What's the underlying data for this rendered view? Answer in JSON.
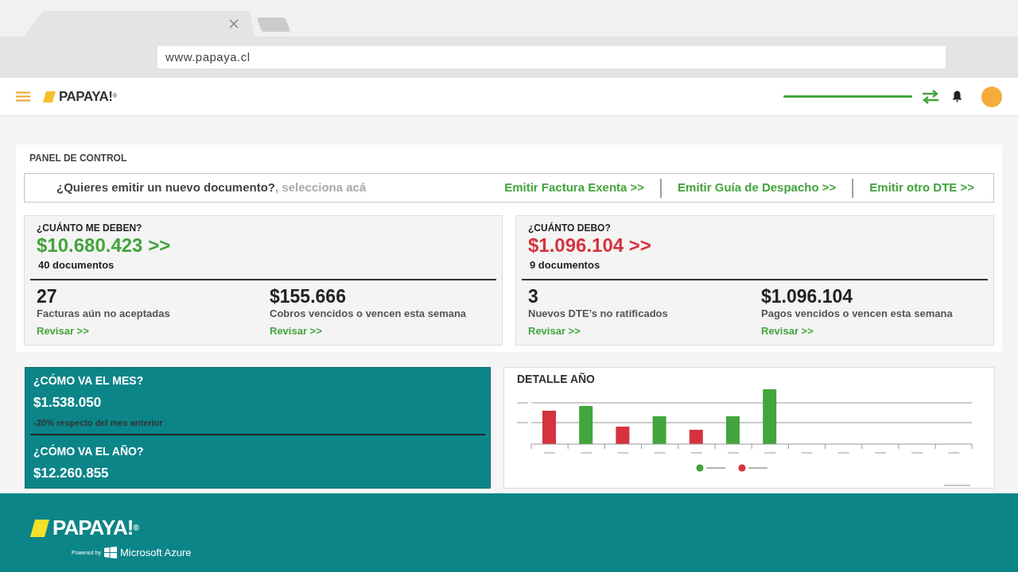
{
  "browser": {
    "url": "www.papaya.cl"
  },
  "header": {
    "logo": "PAPAYA!$^{®}$"
  },
  "panel": {
    "title": "PANEL DE CONTROL",
    "prompt": "¿Quieres emitir un nuevo documento?",
    "hint": ", selecciona acá",
    "actions": [
      "Emitir Factura Exenta >>",
      "Emitir Guía de Despacho >>",
      "Emitir otro DTE >>"
    ]
  },
  "summaries": [
    {
      "kind": "income",
      "title": "¿CUÁNTO ME DEBEN?",
      "amount": "$10.680.423 >>",
      "documents": "40 documentos",
      "stats": [
        {
          "value": "27",
          "label": "Facturas aún no aceptadas",
          "link": "Revisar >>"
        },
        {
          "value": "$155.666",
          "label": "Cobros vencidos o vencen esta semana",
          "link": "Revisar >>"
        }
      ]
    },
    {
      "kind": "expense",
      "title": "¿CUÁNTO DEBO?",
      "amount": "$1.096.104 >>",
      "documents": "9 documentos",
      "stats": [
        {
          "value": "3",
          "label": "Nuevos DTE’s no ratificados",
          "link": "Revisar >>"
        },
        {
          "value": "$1.096.104",
          "label": "Pagos vencidos o vencen esta semana",
          "link": "Revisar >>"
        }
      ]
    }
  ],
  "progress": [
    {
      "title": "¿CÓMO VA EL MES?",
      "value": "$1.538.050",
      "note": "-20% respecto del mes anterior"
    },
    {
      "title": "¿CÓMO VA EL AÑO?",
      "value": "$12.260.855"
    }
  ],
  "chart": {
    "title": "DETALLE AÑO"
  },
  "footer": {
    "logo": "PAPAYA!$^{®}$",
    "powered_by": "Powered by",
    "platform": "Microsoft Azure"
  }
}
